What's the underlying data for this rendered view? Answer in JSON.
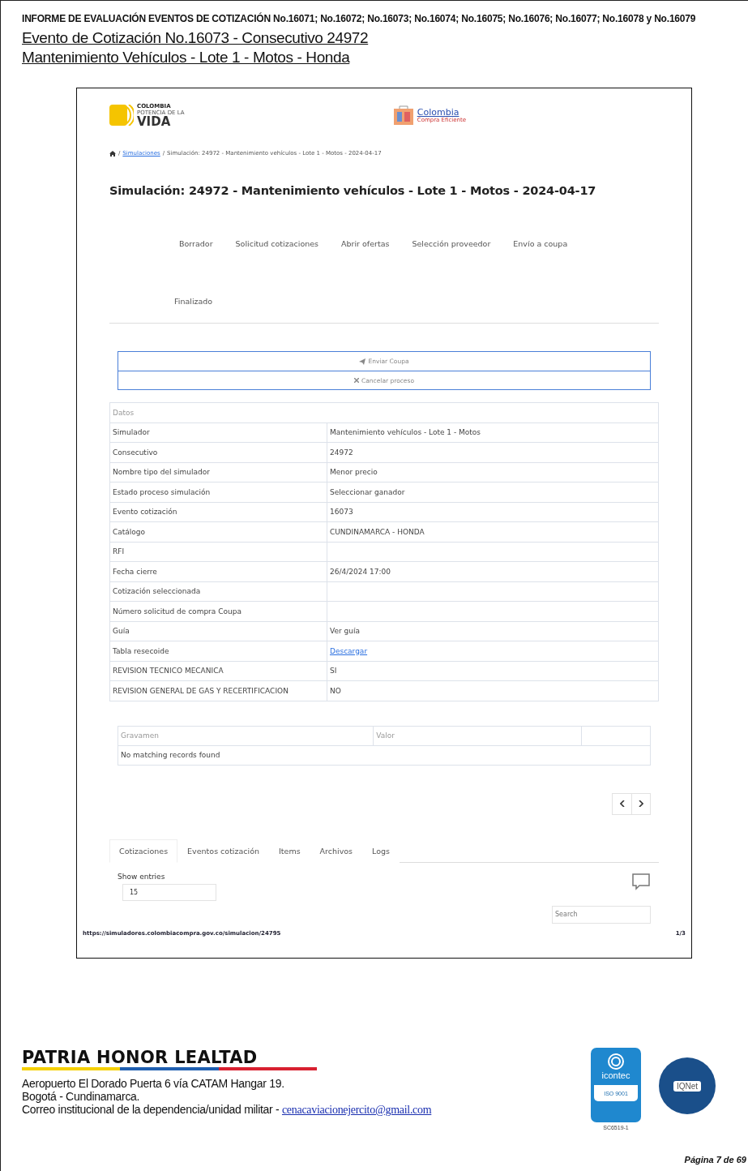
{
  "report_header": {
    "title": "INFORME DE EVALUACIÓN EVENTOS DE COTIZACIÓN No.16071; No.16072; No.16073; No.16074; No.16075; No.16076; No.16077; No.16078 y No.16079",
    "subtitles": [
      "Evento de Cotización No.16073 - Consecutivo 24972",
      "Mantenimiento Vehículos - Lote 1 - Motos - Honda"
    ]
  },
  "screenshot": {
    "logos": {
      "left_small": "COLOMBIA",
      "left_tag": "POTENCIA DE LA",
      "left_big": "VIDA",
      "right_big": "Colombia",
      "right_small": "Compra Eficiente"
    },
    "breadcrumb": [
      {
        "separator": "/",
        "label": "Simulaciones",
        "kind": "link"
      },
      {
        "separator": "/",
        "label": "Simulación: 24972 - Mantenimiento vehículos - Lote 1 - Motos - 2024-04-17",
        "kind": "text"
      }
    ],
    "heading": "Simulación: 24972 - Mantenimiento vehículos - Lote 1 - Motos - 2024-04-17",
    "steps": [
      "Borrador",
      "Solicitud cotizaciones",
      "Abrir ofertas",
      "Selección proveedor",
      "Envío a coupa",
      "Finalizado"
    ],
    "actions": [
      {
        "label": "Enviar Coupa",
        "kind": "send"
      },
      {
        "label": "Cancelar proceso",
        "kind": "cancel"
      }
    ],
    "data_table": {
      "caption": "Datos",
      "rows": [
        {
          "label": "Simulador",
          "value": "Mantenimiento vehículos - Lote 1 - Motos",
          "kind": "text"
        },
        {
          "label": "Consecutivo",
          "value": "24972",
          "kind": "text"
        },
        {
          "label": "Nombre tipo del simulador",
          "value": "Menor precio",
          "kind": "text"
        },
        {
          "label": "Estado proceso simulación",
          "value": "Seleccionar ganador",
          "kind": "text"
        },
        {
          "label": "Evento cotización",
          "value": "16073",
          "kind": "text"
        },
        {
          "label": "Catálogo",
          "value": "CUNDINAMARCA - HONDA",
          "kind": "text"
        },
        {
          "label": "RFI",
          "value": "",
          "kind": "text"
        },
        {
          "label": "Fecha cierre",
          "value": "26/4/2024 17:00",
          "kind": "text"
        },
        {
          "label": "Cotización seleccionada",
          "value": "",
          "kind": "text"
        },
        {
          "label": "Número solicitud de compra Coupa",
          "value": "",
          "kind": "text"
        },
        {
          "label": "Guía",
          "value": "Ver guía",
          "kind": "text"
        },
        {
          "label": "Tabla resecoide",
          "value": "Descargar",
          "kind": "link"
        },
        {
          "label": "REVISION TECNICO MECANICA",
          "value": "SI",
          "kind": "text"
        },
        {
          "label": "REVISION GENERAL DE GAS Y RECERTIFICACION",
          "value": "NO",
          "kind": "text"
        }
      ]
    },
    "tax_table": {
      "columns": [
        "Gravamen",
        "Valor"
      ],
      "empty_message": "No matching records found"
    },
    "tabs": [
      {
        "label": "Cotizaciones",
        "selected": true
      },
      {
        "label": "Eventos cotización",
        "selected": false
      },
      {
        "label": "Items",
        "selected": false
      },
      {
        "label": "Archivos",
        "selected": false
      },
      {
        "label": "Logs",
        "selected": false
      }
    ],
    "show_entries": {
      "label": "Show entries",
      "value": "15"
    },
    "search": {
      "placeholder": "Search"
    },
    "print_footer": {
      "url": "https://simuladores.colombiacompra.gov.co/simulacion/24795",
      "page": "1/3"
    }
  },
  "footer": {
    "motto": "PATRIA HONOR LEALTAD",
    "address_lines": [
      "Aeropuerto El Dorado Puerta 6 vía CATAM Hangar 19.",
      "Bogotá - Cundinamarca."
    ],
    "email_label": "Correo institucional de la dependencia/unidad militar - ",
    "email": "cenacaviacionejercito@gmail.com",
    "cert_labels": [
      "icontec",
      "ISO 9001",
      "SC6519-1",
      "IQNet"
    ],
    "page_number": "Página 7 de 69"
  }
}
